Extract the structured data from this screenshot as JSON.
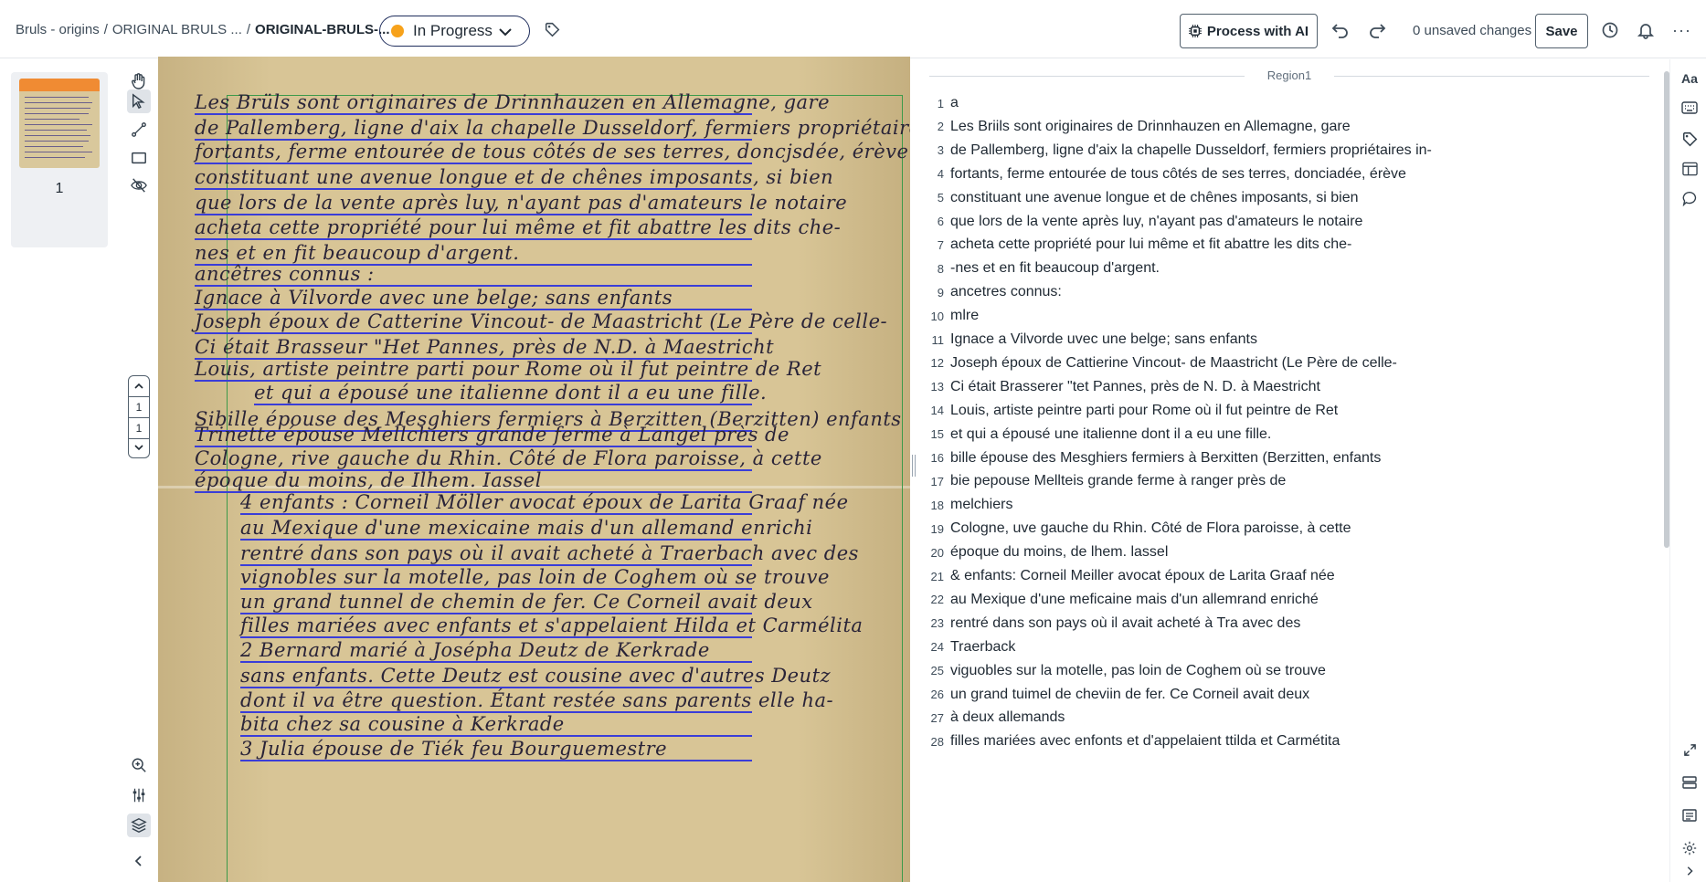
{
  "breadcrumb": {
    "part1": "Bruls - origins",
    "part2": "ORIGINAL BRULS ...",
    "current": "ORIGINAL-BRULS-...",
    "sep": "/"
  },
  "status": {
    "label": "In Progress",
    "color": "#f7a21b"
  },
  "toolbar": {
    "ai_label": "Process with AI",
    "unsaved": "0 unsaved changes",
    "save_label": "Save",
    "more": "···"
  },
  "thumbnails": [
    {
      "page": "1"
    }
  ],
  "pager": {
    "current": "1",
    "total": "1"
  },
  "region": {
    "label": "Region1"
  },
  "document_text": [
    "Les Brüls sont originaires de Drinnhauzen en Allemagne, gare",
    "de Pallemberg, ligne d'aix la chapelle Dusseldorf, fermiers propriétaires in-",
    "fortants, ferme entourée de tous côtés de ses terres, doncjsdée, érève",
    "constituant une avenue longue et de chênes imposants, si bien",
    "que lors de la vente après luy, n'ayant pas d'amateurs le notaire",
    "acheta cette propriété pour lui même et fit abattre les dits che-",
    "nes et en fit beaucoup d'argent.",
    "ancêtres connus :",
    "Ignace à Vilvorde avec une belge; sans enfants",
    "Joseph époux de Catterine Vincout- de Maastricht (Le Père de celle-",
    "Ci était Brasseur \"Het Pannes, près de N.D. à Maestricht",
    "Louis, artiste peintre parti pour Rome où il fut peintre de Ret",
    "et qui a épousé une italienne dont il a eu une fille.",
    "Sibille épouse des Mesghiers fermiers à Berzitten (Berzitten) enfants",
    "Trinette épouse Mellchiers grande ferme à Langel près de",
    "Cologne, rive gauche du Rhin. Côté de Flora paroisse, à cette",
    "époque du moins, de Ilhem. Iassel",
    "4 enfants : Corneil Möller avocat époux de Larita Graaf née",
    "au Mexique d'une mexicaine mais d'un allemand enrichi",
    "rentré dans son pays où il avait acheté à Traerbach avec des",
    "vignobles sur la motelle, pas loin de Coghem où se trouve",
    "un grand tunnel de chemin de fer. Ce Corneil avait deux",
    "filles mariées avec enfants et s'appelaient Hilda et Carmélita",
    "2 Bernard marié à Josépha Deutz de Kerkrade",
    "sans enfants. Cette Deutz est cousine avec d'autres Deutz",
    "dont il va être question. Étant restée sans parents elle ha-",
    "bita chez sa cousine à Kerkrade",
    "3 Julia épouse de Tiék feu Bourguemestre"
  ],
  "lines": [
    {
      "num": "1",
      "text": "a"
    },
    {
      "num": "2",
      "text": "Les Briils sont originaires de Drinnhauzen en Allemagne, gare"
    },
    {
      "num": "3",
      "text": "de Pallemberg, ligne d'aix la chapelle Dusseldorf, fermiers propriétaires in-"
    },
    {
      "num": "4",
      "text": "fortants, ferme entourée de tous côtés de ses terres, donciadée, érève"
    },
    {
      "num": "5",
      "text": "constituant une avenue longue et de chênes imposants, si bien"
    },
    {
      "num": "6",
      "text": "que lors de la vente après luy, n'ayant pas d'amateurs le notaire"
    },
    {
      "num": "7",
      "text": "acheta cette propriété pour lui même et fit abattre les dits che-"
    },
    {
      "num": "8",
      "text": "-nes et en fit beaucoup d'argent."
    },
    {
      "num": "9",
      "text": "ancetres connus:"
    },
    {
      "num": "10",
      "text": "mlre"
    },
    {
      "num": "11",
      "text": "Ignace a Vilvorde uvec une belge; sans enfants"
    },
    {
      "num": "12",
      "text": "Joseph époux de Cattierine Vincout- de Maastricht (Le Père de celle-"
    },
    {
      "num": "13",
      "text": "Ci était Brasserer \"tet Pannes, près de N. D. à Maestricht"
    },
    {
      "num": "14",
      "text": "Louis, artiste peintre parti pour Rome où il fut peintre de Ret"
    },
    {
      "num": "15",
      "text": "et qui a épousé une italienne dont il a eu une fille."
    },
    {
      "num": "16",
      "text": "bille épouse des Mesghiers fermiers à Berxitten (Berzitten, enfants"
    },
    {
      "num": "17",
      "text": "bie pepouse Mellteis grande ferme à ranger près de"
    },
    {
      "num": "18",
      "text": "melchiers"
    },
    {
      "num": "19",
      "text": "Cologne, uve gauche du Rhin. Côté de Flora paroisse, à cette"
    },
    {
      "num": "20",
      "text": "époque du moins, de lhem. lassel"
    },
    {
      "num": "21",
      "text": "& enfants: Corneil Meiller avocat époux de Larita Graaf née"
    },
    {
      "num": "22",
      "text": "au Mexique d'une meficaine mais d'un allemrand enriché"
    },
    {
      "num": "23",
      "text": "rentré dans son pays où il avait acheté à Tra avec des"
    },
    {
      "num": "24",
      "text": "Traerback"
    },
    {
      "num": "25",
      "text": "viguobles sur la motelle, pas loin de Coghem où se trouve"
    },
    {
      "num": "26",
      "text": "un grand tuimel de cheviin de fer. Ce Corneil avait deux"
    },
    {
      "num": "27",
      "text": "à deux allemands"
    },
    {
      "num": "28",
      "text": "filles mariées avec enfonts et d'appelaient ttilda et Carmétita"
    }
  ],
  "rail": {
    "font_label": "Aa"
  },
  "colors": {
    "accent": "#1f2d5c",
    "status": "#f7a21b",
    "region_box": "#3c9a4a",
    "baseline": "#3a3dd8"
  }
}
